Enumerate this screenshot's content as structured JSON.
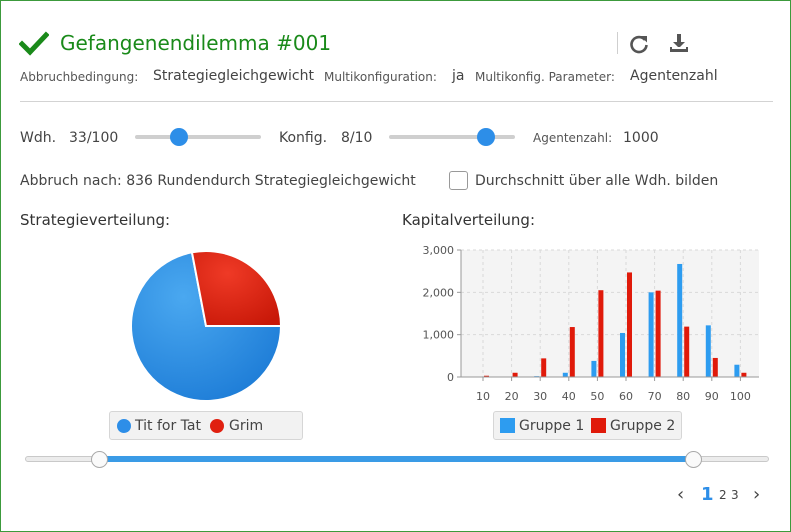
{
  "header": {
    "title": "Gefangenendilemma #001",
    "success_icon": "check-icon",
    "refresh_icon": "refresh-icon",
    "download_icon": "download-icon",
    "accent_color": "#1a8a1a"
  },
  "meta": {
    "abbruch_label": "Abbruchbedingung:",
    "abbruch_value": "Strategiegleichgewicht",
    "multi_label": "Multikonfiguration:",
    "multi_value": "ja",
    "param_label": "Multikonfig. Parameter:",
    "param_value": "Agentenzahl"
  },
  "controls": {
    "wdh_label": "Wdh.",
    "wdh_value": "33/100",
    "wdh_fraction": 0.33,
    "konfig_label": "Konfig.",
    "konfig_value": "8/10",
    "konfig_fraction": 0.8,
    "agenten_label": "Agentenzahl:",
    "agenten_value": "1000",
    "abbruch_text": "Abbruch nach: 836 Rundendurch Strategiegleichgewicht",
    "checkbox_label": "Durchschnitt über alle Wdh. bilden",
    "checkbox_checked": false
  },
  "strategy": {
    "title": "Strategieverteilung:",
    "legend": [
      {
        "label": "Tit for Tat",
        "color": "#2d8ee8"
      },
      {
        "label": "Grim",
        "color": "#e02010"
      }
    ]
  },
  "capital": {
    "title": "Kapitalverteilung:",
    "legend": [
      {
        "label": "Gruppe 1",
        "color": "#2d9cf0"
      },
      {
        "label": "Gruppe 2",
        "color": "#e01a0a"
      }
    ]
  },
  "range": {
    "low_fraction": 0.1,
    "high_fraction": 0.9
  },
  "pager": {
    "prev": "‹",
    "next": "›",
    "pages": [
      "1",
      "2",
      "3"
    ],
    "active_page": "1"
  },
  "chart_data": [
    {
      "type": "pie",
      "labels": [
        "Tit for Tat",
        "Grim"
      ],
      "values": [
        72,
        28
      ],
      "colors": [
        "#2d8ee8",
        "#e02010"
      ]
    },
    {
      "type": "bar",
      "categories": [
        "10",
        "20",
        "30",
        "40",
        "50",
        "60",
        "70",
        "80",
        "90",
        "100"
      ],
      "series": [
        {
          "name": "Gruppe 1",
          "color": "#2d9cf0",
          "values": [
            0,
            0,
            20,
            100,
            380,
            1040,
            2000,
            2670,
            1220,
            290
          ]
        },
        {
          "name": "Gruppe 2",
          "color": "#e01a0a",
          "values": [
            30,
            100,
            440,
            1180,
            2050,
            2470,
            2040,
            1190,
            450,
            100
          ]
        }
      ],
      "yticks": [
        "0",
        "1,000",
        "2,000",
        "3,000"
      ],
      "ylim": [
        0,
        3000
      ],
      "grid": true
    }
  ]
}
